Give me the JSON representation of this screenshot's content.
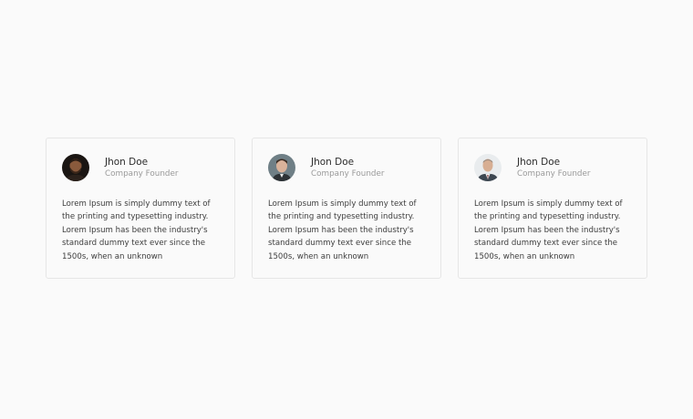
{
  "testimonials": [
    {
      "name": "Jhon Doe",
      "role": "Company Founder",
      "text": "Lorem Ipsum is simply dummy text of the printing and typesetting industry. Lorem Ipsum has been the industry's standard dummy text ever since the 1500s, when an unknown",
      "avatar": "man-beard-portrait"
    },
    {
      "name": "Jhon Doe",
      "role": "Company Founder",
      "text": "Lorem Ipsum is simply dummy text of the printing and typesetting industry. Lorem Ipsum has been the industry's standard dummy text ever since the 1500s, when an unknown",
      "avatar": "young-man-portrait"
    },
    {
      "name": "Jhon Doe",
      "role": "Company Founder",
      "text": "Lorem Ipsum is simply dummy text of the printing and typesetting industry. Lorem Ipsum has been the industry's standard dummy text ever since the 1500s, when an unknown",
      "avatar": "man-suit-portrait"
    }
  ]
}
